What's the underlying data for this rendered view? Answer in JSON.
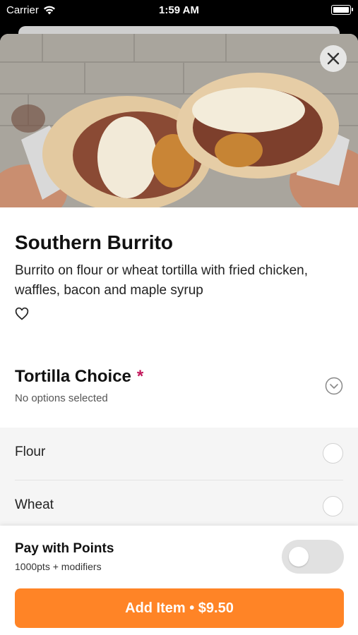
{
  "status_bar": {
    "carrier": "Carrier",
    "time": "1:59 AM"
  },
  "item": {
    "title": "Southern Burrito",
    "description": "Burrito on flour or wheat tortilla with fried chicken, waffles, bacon and maple syrup"
  },
  "tortilla": {
    "title": "Tortilla Choice",
    "required_mark": "*",
    "subtitle": "No options selected",
    "options": [
      "Flour",
      "Wheat"
    ]
  },
  "points": {
    "title": "Pay with Points",
    "subtitle": "1000pts + modifiers",
    "enabled": false
  },
  "add_button": {
    "label": "Add Item • $9.50"
  },
  "colors": {
    "accent": "#ff8426",
    "required": "#c2185b"
  }
}
